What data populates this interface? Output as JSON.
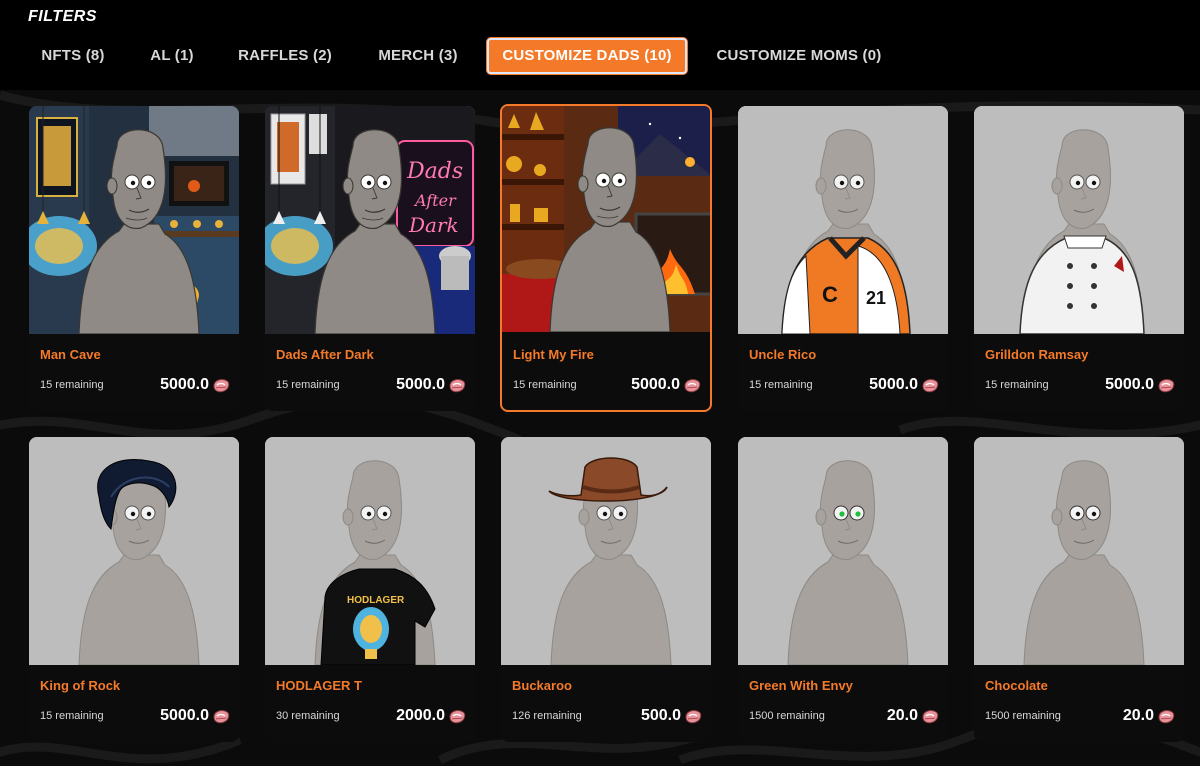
{
  "header": {
    "title": "FILTERS"
  },
  "tabs": [
    {
      "label": "NFTS (8)",
      "active": false
    },
    {
      "label": "AL (1)",
      "active": false
    },
    {
      "label": "RAFFLES (2)",
      "active": false
    },
    {
      "label": "MERCH (3)",
      "active": false
    },
    {
      "label": "CUSTOMIZE DADS (10)",
      "active": true
    },
    {
      "label": "CUSTOMIZE MOMS (0)",
      "active": false
    }
  ],
  "products": [
    {
      "name": "Man Cave",
      "remaining": "15 remaining",
      "price": "5000.0",
      "art": "man-cave",
      "selected": false
    },
    {
      "name": "Dads After Dark",
      "remaining": "15 remaining",
      "price": "5000.0",
      "art": "dads-after-dark",
      "selected": false
    },
    {
      "name": "Light My Fire",
      "remaining": "15 remaining",
      "price": "5000.0",
      "art": "light-my-fire",
      "selected": true
    },
    {
      "name": "Uncle Rico",
      "remaining": "15 remaining",
      "price": "5000.0",
      "art": "letterman-jacket",
      "selected": false
    },
    {
      "name": "Grilldon Ramsay",
      "remaining": "15 remaining",
      "price": "5000.0",
      "art": "chef-jacket",
      "selected": false
    },
    {
      "name": "King of Rock",
      "remaining": "15 remaining",
      "price": "5000.0",
      "art": "pompadour-hair",
      "selected": false
    },
    {
      "name": "HODLAGER T",
      "remaining": "30 remaining",
      "price": "2000.0",
      "art": "black-tshirt",
      "selected": false
    },
    {
      "name": "Buckaroo",
      "remaining": "126 remaining",
      "price": "500.0",
      "art": "cowboy-hat",
      "selected": false
    },
    {
      "name": "Green With Envy",
      "remaining": "1500 remaining",
      "price": "20.0",
      "art": "green-eyes",
      "selected": false
    },
    {
      "name": "Chocolate",
      "remaining": "1500 remaining",
      "price": "20.0",
      "art": "plain-dad",
      "selected": false
    }
  ],
  "decor": {
    "dads_sign_lines": [
      "Dads",
      "After",
      "Dark"
    ],
    "jacket_letter": "C",
    "jacket_number": "21",
    "shirt_text": "HODLAGER"
  },
  "colors": {
    "accent": "#f47a2a",
    "background": "#0b0b0b",
    "card": "#0c0c0c",
    "placeholder": "#bdbdbd",
    "dad_skin": "#8f8a85"
  },
  "icons": {
    "currency": "steak-icon"
  }
}
